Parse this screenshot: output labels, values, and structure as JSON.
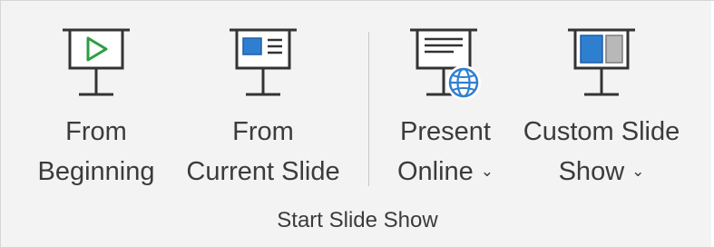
{
  "group": {
    "title": "Start Slide Show"
  },
  "buttons": [
    {
      "line1": "From",
      "line2": "Beginning",
      "icon": "presentation-play-icon",
      "has_dropdown": false
    },
    {
      "line1": "From",
      "line2": "Current Slide",
      "icon": "presentation-current-slide-icon",
      "has_dropdown": false
    },
    {
      "line1": "Present",
      "line2": "Online",
      "icon": "presentation-online-globe-icon",
      "has_dropdown": true
    },
    {
      "line1": "Custom Slide",
      "line2": "Show",
      "icon": "presentation-custom-show-icon",
      "has_dropdown": true
    }
  ],
  "colors": {
    "accent_blue": "#2f7fd1",
    "light_blue": "#9cc7ef",
    "play_green": "#2e9e44",
    "icon_stroke": "#333333",
    "background": "#f3f3f3"
  }
}
